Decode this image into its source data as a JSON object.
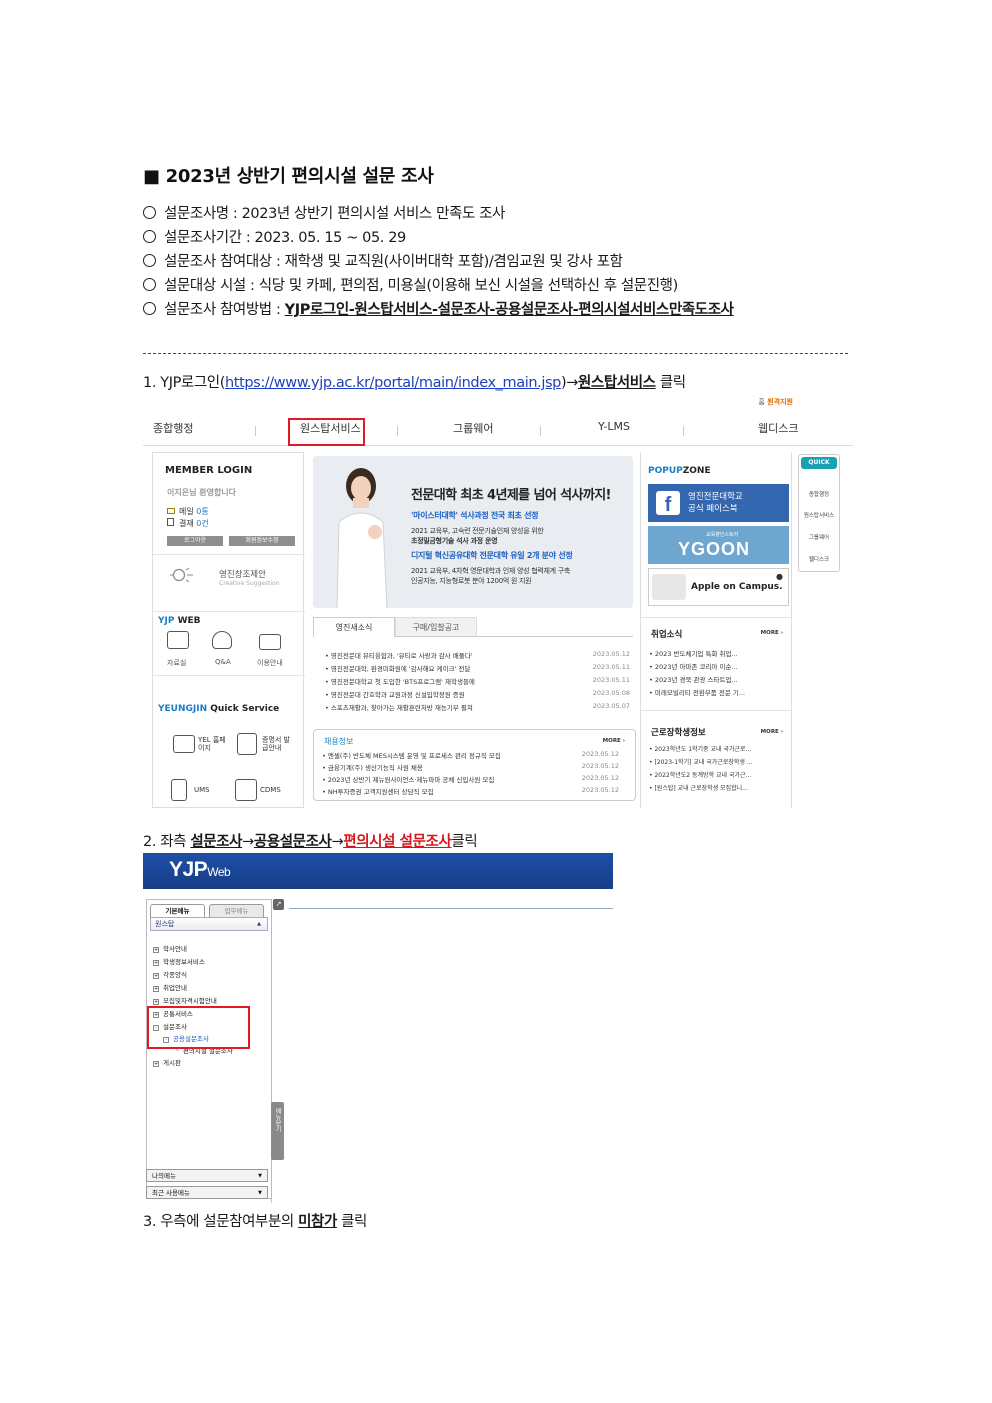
{
  "doc": {
    "title": "■ 2023년 상반기 편의시설 설문 조사",
    "info": [
      {
        "text": "설문조사명 : 2023년 상반기 편의시설 서비스 만족도 조사",
        "emphasis": ""
      },
      {
        "text": "설문조사기간 : 2023. 05. 15 ~ 05. 29",
        "emphasis": ""
      },
      {
        "text": "설문조사 참여대상 : 재학생 및 교직원(사이버대학 포함)/겸임교원 및 강사 포함",
        "emphasis": ""
      },
      {
        "text": "설문대상 시설 : 식당 및 카페, 편의점, 미용실(이용해 보신 시설을 선택하신 후 설문진행)",
        "emphasis": ""
      },
      {
        "text": "설문조사 참여방법 : ",
        "emphasis": "YJP로그인-원스탑서비스-설문조사-공용설문조사-편의시설서비스만족도조사"
      }
    ]
  },
  "step1": {
    "prefix": "1. YJP로그인(",
    "url": "https://www.yjp.ac.kr/portal/main/index_main.jsp",
    "mid": ")→",
    "target": "원스탑서비스",
    "suffix": " 클릭"
  },
  "step2": {
    "prefix": "2. 좌측 ",
    "a": "설문조사",
    "arrow1": "→",
    "b": "공용설문조사",
    "arrow2": "→",
    "c": "편의시설 설문조사",
    "suffix": "클릭"
  },
  "step3": {
    "prefix": "3. 우측에 설문참여부분의 ",
    "target": "미참가",
    "suffix": " 클릭"
  },
  "portal": {
    "util": {
      "home": "홈",
      "remote": "원격지원"
    },
    "gnb": [
      "종합행정",
      "원스탑서비스",
      "그룹웨어",
      "Y-LMS",
      "웹디스크"
    ],
    "login": {
      "title": "MEMBER LOGIN",
      "welcome": "이지은님 환영합니다",
      "mail_label": "메일",
      "mail_count": "0통",
      "approval_label": "결재",
      "approval_count": "0건",
      "logout": "로그아웃",
      "member_edit": "회원정보수정",
      "suggest": "영진창조제안",
      "suggest_en": "Creative Suggestion"
    },
    "yjpweb": {
      "title_a": "YJP",
      "title_b": " WEB",
      "items": [
        "자료실",
        "Q&A",
        "이용안내"
      ]
    },
    "quickservice": {
      "title_a": "YEUNGJIN",
      "title_b": " Quick Service",
      "items": [
        "YEL 홈페이지",
        "증명서 발급안내",
        "UMS",
        "CDMS"
      ]
    },
    "banner": {
      "headline": "전문대학 최초 4년제를 넘어 석사까지!",
      "line1": "'마이스터대학' 석사과정 전국 최초 선정",
      "line2": "2021 교육부, 고숙련 전문기술인재 양성을 위한",
      "line3": "초정밀금형기술 석사 과정 운영",
      "line4": "디지털 혁신공유대학 전문대학 유일 2개 분야 선정",
      "line5": "2021 교육부, 4차혁 영문대학과 인재 양성 협력체계 구축",
      "line6": "인공지능, 지능형로봇 분야 1200억 원 지원"
    },
    "tabs": [
      "영진새소식",
      "구매/입찰공고"
    ],
    "news": [
      {
        "title": "영진전문대 뷰티융합과, '뷰티로 사랑과 감사 배풀다'",
        "date": "2023.05.12"
      },
      {
        "title": "영진전문대학, 환경미화원에 '감사해요 케이크' 전달",
        "date": "2023.05.11"
      },
      {
        "title": "영진전문대학교 첫 도입한 'BTS프로그램' 재학생들에",
        "date": "2023.05.11"
      },
      {
        "title": "영진전문대 간호학과 교원과정 신설입학정원 증원",
        "date": "2023.05.08"
      },
      {
        "title": "스포츠재활과, 찾아가는 재활훈련처방 재능기부 펼쳐",
        "date": "2023.05.07"
      }
    ],
    "jobs": {
      "title": "채용정보",
      "more": "MORE ›",
      "items": [
        {
          "title": "엔셀(주) 반도체 MES시스템 운영 및 프로세스 관리 정규직 모집",
          "date": "2023.05.12"
        },
        {
          "title": "금융기계(주) 생산기능직 사원 채용",
          "date": "2023.05.12"
        },
        {
          "title": "2023년 상반기 제뉴원사이언스·제뉴파마 공채 신입사원 모집",
          "date": "2023.05.12"
        },
        {
          "title": "NH투자증권 고객지원센터 상담직 모집",
          "date": "2023.05.12"
        }
      ]
    },
    "popup": {
      "title_a": "POPUP",
      "title_b": "ZONE",
      "fb_line1": "영진전문대학교",
      "fb_line2": "공식 페이스북",
      "ygoon_small": "교육향인스토어",
      "ygoon": "YGOON",
      "apple": "Apple on Campus."
    },
    "employment": {
      "title": "취업소식",
      "more": "MORE ›",
      "items": [
        "2023 반도체기업 특화 취업...",
        "2023년 아마존 코리아 이순...",
        "2023년 경북 관광 스타트업...",
        "미래모빌리티 전환부품 전문 기..."
      ]
    },
    "scholarship": {
      "title": "근로장학생정보",
      "more": "MORE ›",
      "items": [
        "2023학년도 1학기중 교내 국가근로...",
        "[2023-1학기] 교내 국가근로장학생 ...",
        "2022학년도2 동계방학 교내 국가근...",
        "[원스탑] 교내 근로장학생 모집합니..."
      ]
    },
    "quick": {
      "label": "QUICK",
      "items": [
        "종합행정",
        "원스탑서비스",
        "그룹웨어",
        "웹디스크"
      ]
    }
  },
  "yjpweb": {
    "logo": "YJP",
    "logo_sub": "Web",
    "tabs": [
      "기본메뉴",
      "업무메뉴"
    ],
    "selector": "원스탑",
    "menu": [
      "학사안내",
      "학생정보서비스",
      "각종양식",
      "취업안내",
      "모집및자격시험안내",
      "공통서비스",
      "설문조사"
    ],
    "sub1": "공용설문조사",
    "sub2": "편의시설 설문조사",
    "last": "게시판",
    "toggle": "메뉴닫기",
    "bottom": [
      "나의메뉴",
      "최근 사용메뉴"
    ]
  }
}
